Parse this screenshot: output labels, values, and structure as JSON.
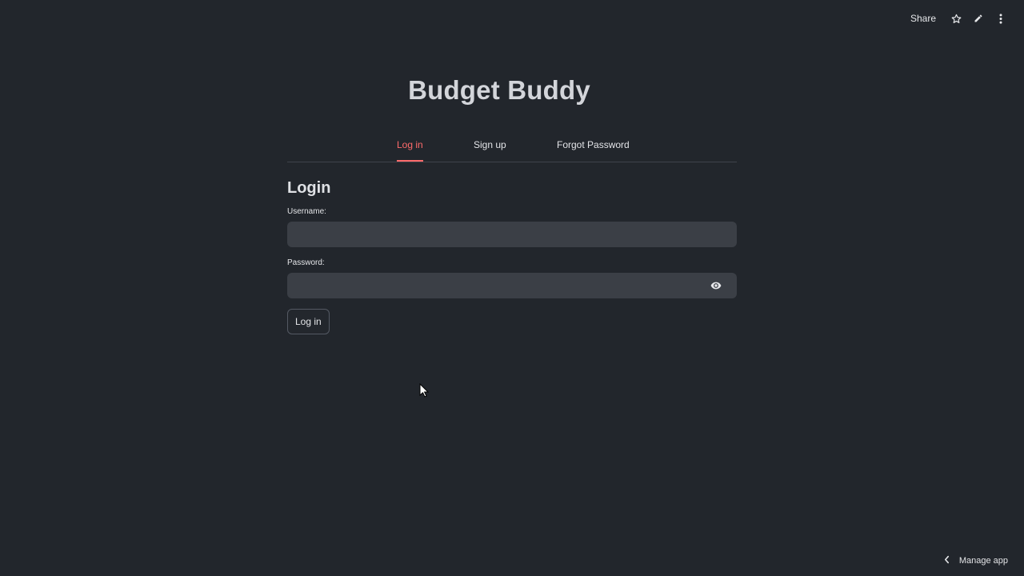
{
  "toolbar": {
    "share_label": "Share",
    "icons": [
      "star-icon",
      "pencil-icon",
      "more-vertical-icon"
    ]
  },
  "app": {
    "title": "Budget Buddy"
  },
  "tabs": [
    {
      "label": "Log in",
      "active": true
    },
    {
      "label": "Sign up",
      "active": false
    },
    {
      "label": "Forgot Password",
      "active": false
    }
  ],
  "login_form": {
    "heading": "Login",
    "username_label": "Username:",
    "username_value": "",
    "password_label": "Password:",
    "password_value": "",
    "submit_label": "Log in"
  },
  "footer": {
    "manage_app_label": "Manage app"
  },
  "colors": {
    "background": "#22262c",
    "accent": "#ff6b6b",
    "input_bg": "#3b3f46"
  }
}
